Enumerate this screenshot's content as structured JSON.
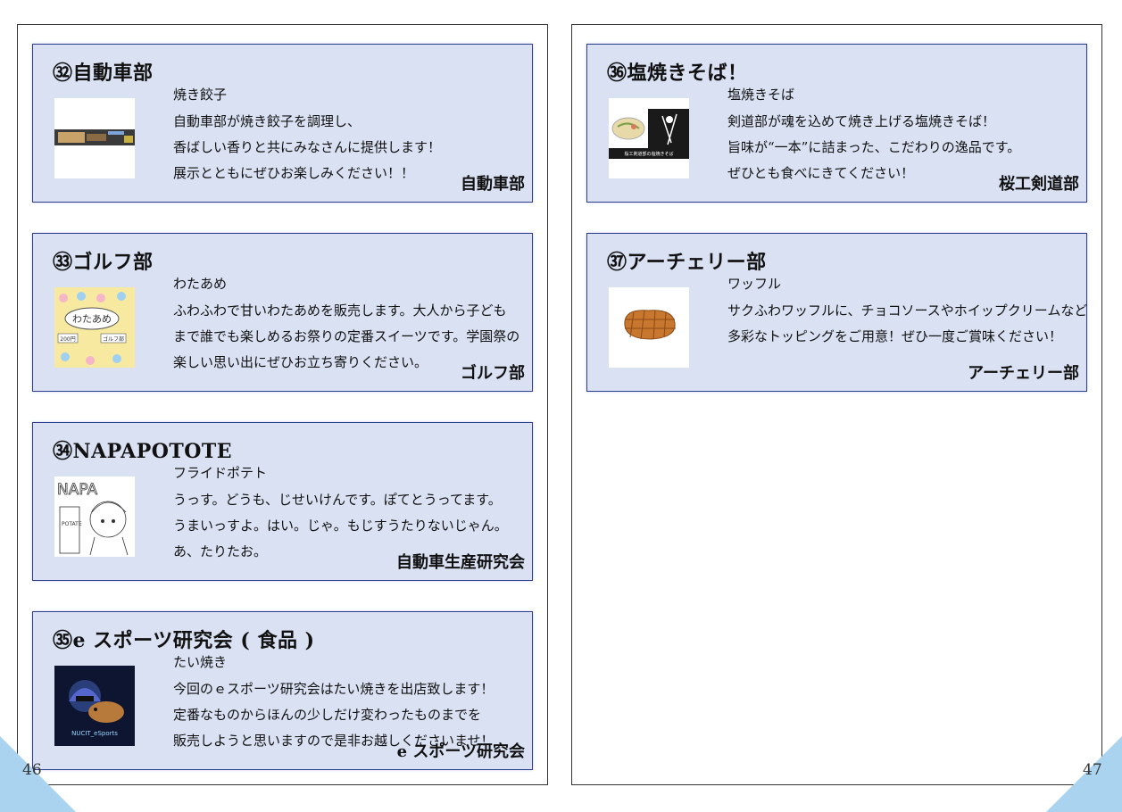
{
  "left_page": {
    "page_number": "46",
    "cards": [
      {
        "title": "㉜自動車部",
        "item": "焼き餃子",
        "lines": [
          "自動車部が焼き餃子を調理し、",
          "香ばしい香りと共にみなさんに提供します！",
          "展示とともにぜひお楽しみください！！"
        ],
        "org": "自動車部",
        "thumb_icon": "gyoza-photo"
      },
      {
        "title": "㉝ゴルフ部",
        "item": "わたあめ",
        "lines": [
          "ふわふわで甘いわたあめを販売します。大人から子ども",
          "まで誰でも楽しめるお祭りの定番スイーツです。学園祭の",
          "楽しい思い出にぜひお立ち寄りください。"
        ],
        "org": "ゴルフ部",
        "thumb_icon": "cotton-candy-poster",
        "thumb_text": [
          "わたあめ",
          "200円",
          "ゴルフ部"
        ]
      },
      {
        "title": "㉞NAPAPOTOTE",
        "item": "フライドポテト",
        "lines": [
          "うっす。どうも、じせいけんです。ぽてとうってます。",
          "うまいっすよ。はい。じゃ。もじすうたりないじゃん。",
          "あ、たりたお。"
        ],
        "org": "自動車生産研究会",
        "thumb_icon": "sketch-drawing",
        "thumb_text": [
          "NAPA",
          "POTATE"
        ]
      },
      {
        "title": "㉟e スポーツ研究会 ( 食品 )",
        "item": "たい焼き",
        "lines": [
          "今回のｅスポーツ研究会はたい焼きを出店致します！",
          "定番なものからほんの少しだけ変わったものまでを",
          "販売しようと思いますので是非お越しくださいませ！"
        ],
        "org": "e スポーツ研究会",
        "thumb_icon": "esports-logo",
        "thumb_text": [
          "NUCIT_eSports"
        ]
      }
    ]
  },
  "right_page": {
    "page_number": "47",
    "cards": [
      {
        "title": "㊱塩焼きそば！",
        "item": "塩焼きそば",
        "lines": [
          "剣道部が魂を込めて焼き上げる塩焼きそば！",
          "旨味が“一本”に詰まった、こだわりの逸品です。",
          "ぜひとも食べにきてください！"
        ],
        "org": "桜工剣道部",
        "thumb_icon": "yakisoba-kendo-image",
        "thumb_text": [
          "桜工剣道部の塩焼きそば"
        ]
      },
      {
        "title": "㊲アーチェリー部",
        "item": "ワッフル",
        "lines": [
          "サクふわワッフルに、チョコソースやホイップクリームなど",
          "多彩なトッピングをご用意！ぜひ一度ご賞味ください！"
        ],
        "org": "アーチェリー部",
        "thumb_icon": "waffle-icon"
      }
    ]
  },
  "colors": {
    "card_bg": "#d9e1f3",
    "card_border": "#2f3e8f",
    "corner": "#a9d3ee"
  }
}
